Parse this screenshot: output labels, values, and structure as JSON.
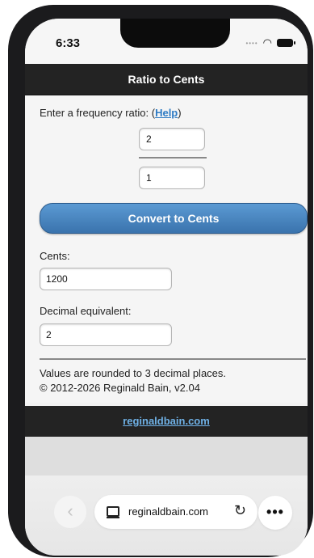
{
  "status_bar": {
    "time": "6:33",
    "signal_icon": "cellular-signal-icon",
    "wifi_icon": "wifi-icon",
    "battery_icon": "battery-icon"
  },
  "header": {
    "title": "Ratio to Cents"
  },
  "form": {
    "prompt_label": "Enter a frequency ratio: (",
    "help_link": "Help",
    "prompt_close": ")",
    "numerator_value": "2",
    "denominator_value": "1",
    "convert_button": "Convert to Cents"
  },
  "results": {
    "cents_label": "Cents:",
    "cents_value": "1200",
    "decimal_label": "Decimal equivalent:",
    "decimal_value": "2"
  },
  "notes": {
    "rounding": "Values are rounded to 3 decimal places.",
    "copyright": "© 2012-2026 Reginald Bain, v2.04"
  },
  "footer": {
    "link_text": "reginaldbain.com"
  },
  "browser": {
    "back_icon": "chevron-left-icon",
    "url": "reginaldbain.com",
    "tabs_icon": "tabs-icon",
    "reload_icon": "reload-icon",
    "more_icon": "more-icon"
  }
}
